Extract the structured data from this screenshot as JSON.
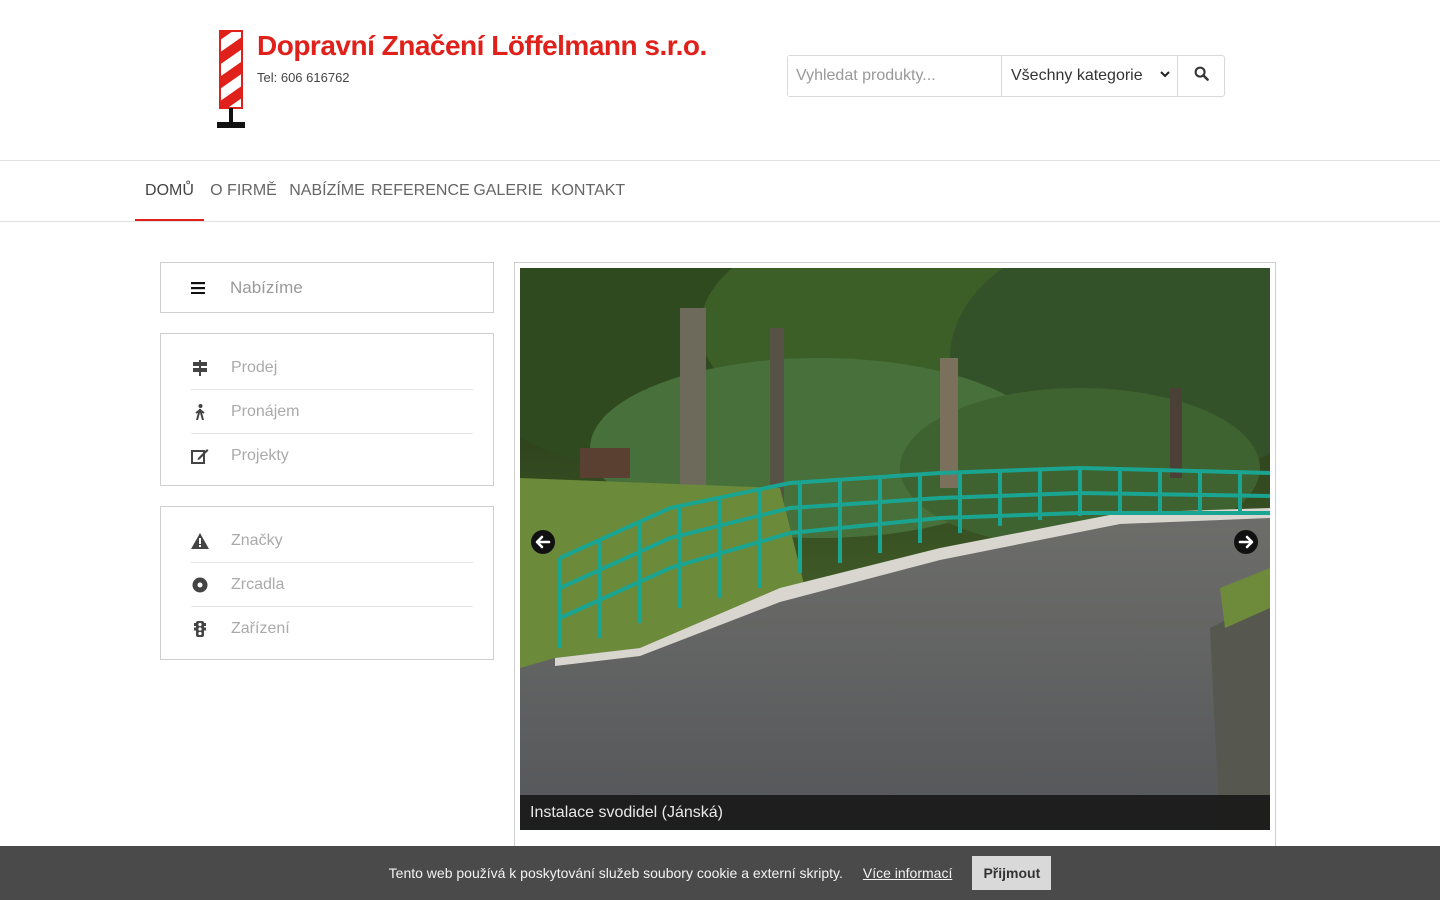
{
  "header": {
    "company_name": "Dopravní Značení Löffelmann s.r.o.",
    "phone": "Tel: 606 616762",
    "search_placeholder": "Vyhledat produkty...",
    "category_selected": "Všechny kategorie"
  },
  "nav": {
    "items": [
      {
        "label": "DOMŮ",
        "active": true
      },
      {
        "label": "O FIRMĚ",
        "active": false
      },
      {
        "label": "NABÍZÍME",
        "active": false
      },
      {
        "label": "REFERENCE",
        "active": false
      },
      {
        "label": "GALERIE",
        "active": false
      },
      {
        "label": "KONTAKT",
        "active": false
      }
    ]
  },
  "sidebar": {
    "title": "Nabízíme",
    "group1": [
      {
        "label": "Prodej",
        "icon": "signpost-icon"
      },
      {
        "label": "Pronájem",
        "icon": "walking-person-icon"
      },
      {
        "label": "Projekty",
        "icon": "edit-icon"
      }
    ],
    "group2": [
      {
        "label": "Značky",
        "icon": "warning-icon"
      },
      {
        "label": "Zrcadla",
        "icon": "circle-dot-icon"
      },
      {
        "label": "Zařízení",
        "icon": "traffic-light-icon"
      }
    ]
  },
  "slider": {
    "caption": "Instalace svodidel (Jánská)"
  },
  "cookie": {
    "text": "Tento web používá k poskytování služeb soubory cookie a externí skripty.",
    "more_info": "Více informací",
    "accept": "Přijmout"
  },
  "colors": {
    "brand_red": "#e0201a",
    "railing_teal": "#1aa592",
    "cookie_bar": "#4a4a4a"
  }
}
